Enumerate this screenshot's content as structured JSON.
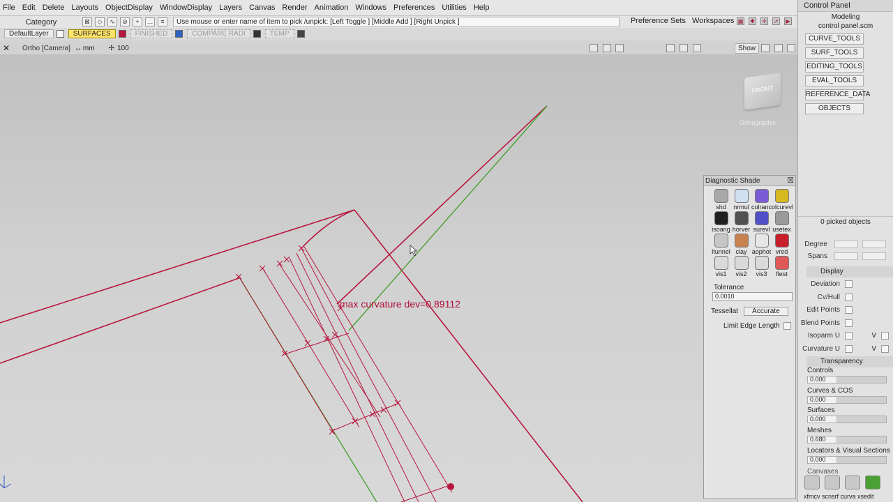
{
  "menubar": [
    "File",
    "Edit",
    "Delete",
    "Layouts",
    "ObjectDisplay",
    "WindowDisplay",
    "Layers",
    "Canvas",
    "Render",
    "Animation",
    "Windows",
    "Preferences",
    "Utilities",
    "Help"
  ],
  "toolbar": {
    "category": "Category",
    "prompt": "Use mouse or enter name of item to pick /unpick: [Left Toggle ] [Middle Add ] [Right Unpick ]",
    "preference_sets": "Preference Sets",
    "workspaces": "Workspaces"
  },
  "layers": {
    "default": "DefaultLayer",
    "surfaces": "SURFACES",
    "finished": "FINISHED",
    "compare": "COMPARE RADI",
    "temp": "TEMP",
    "surfaces_color": "#b8163e"
  },
  "viewport": {
    "title": "Ortho [Camera]",
    "units": "mm",
    "zoom": "100",
    "show": "Show",
    "view_cube": "FRONT",
    "view_label": "Orthographic",
    "curvature_label": "max curvature dev=0.89112",
    "curve_color": "#b8163e",
    "green_color": "#4aa032"
  },
  "diagnostic": {
    "title": "Diagnostic Shade",
    "shaders": [
      {
        "label": "shd",
        "color": "#a8a8a8"
      },
      {
        "label": "nrmul",
        "color": "#cfe0f2"
      },
      {
        "label": "colranc",
        "color": "#7b5bd6"
      },
      {
        "label": "olcurevl",
        "color": "#d6b820"
      },
      {
        "label": "isoang",
        "color": "#202020"
      },
      {
        "label": "horver",
        "color": "#505050"
      },
      {
        "label": "surevl",
        "color": "#5050c8"
      },
      {
        "label": "usetex",
        "color": "#9a9a9a"
      },
      {
        "label": "ltunnel",
        "color": "#c6c6c6"
      },
      {
        "label": "clay",
        "color": "#c88250"
      },
      {
        "label": "aophot",
        "color": "#e6e6e6"
      },
      {
        "label": "vred",
        "color": "#c81e2a"
      },
      {
        "label": "vis1",
        "color": "#dadada"
      },
      {
        "label": "vis2",
        "color": "#dadada"
      },
      {
        "label": "vis3",
        "color": "#dadada"
      },
      {
        "label": "flest",
        "color": "#e05a5a"
      }
    ],
    "tolerance_label": "Tolerance",
    "tolerance_value": "0.0010",
    "tessellator_label": "Tessellat",
    "tessellator_value": "Accurate",
    "limit_edge_length": "Limit Edge Length"
  },
  "control_panel": {
    "title": "Control Panel",
    "mode": "Modeling",
    "file": "control panel.scm",
    "shelves": [
      "CURVE_TOOLS",
      "SURF_TOOLS",
      "EDITING_TOOLS",
      "EVAL_TOOLS",
      "REFERENCE_DATA",
      "OBJECTS"
    ],
    "picked": "0 picked objects",
    "degree": "Degree",
    "spans": "Spans",
    "display_section": "Display",
    "display_items": [
      "Deviation",
      "Cv/Hull",
      "Edit Points",
      "Blend Points",
      "Isoparm U",
      "Curvature U"
    ],
    "v_label": "V",
    "transparency_section": "Transparency",
    "transparency": [
      {
        "label": "Controls",
        "value": "0.000"
      },
      {
        "label": "Curves & COS",
        "value": "0.000"
      },
      {
        "label": "Surfaces",
        "value": "0.000"
      },
      {
        "label": "Meshes",
        "value": "0.680"
      },
      {
        "label": "Locators & Visual Sections",
        "value": "0.000"
      }
    ],
    "canvases": "Canvases",
    "bottom_icons": "xfmcv scnsrf curva xsedit"
  }
}
